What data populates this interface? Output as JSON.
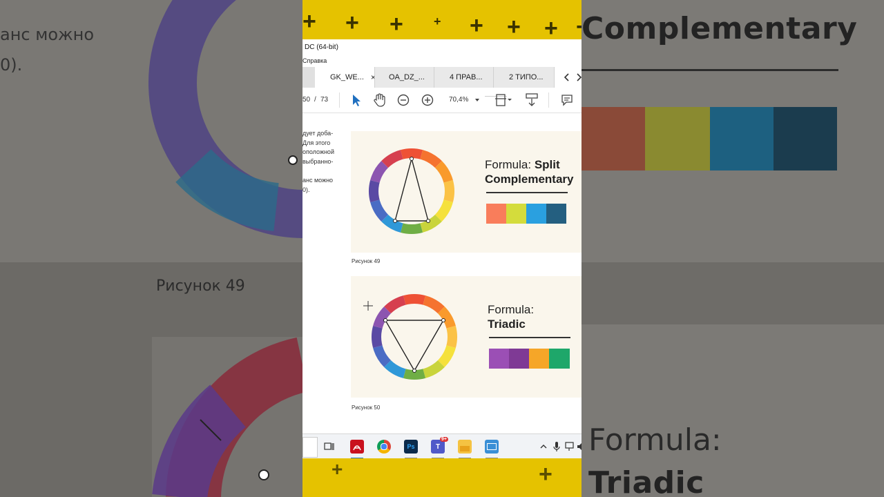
{
  "background_left": {
    "text_line1": "анс можно",
    "text_line2": "0).",
    "caption": "Рисунок 49"
  },
  "background_right": {
    "title": "Complementary",
    "formula_label": "Formula:",
    "formula_name": "Triadic",
    "swatches": [
      "#c0533a",
      "#b8b830",
      "#1d7fb0",
      "#1b4b62"
    ]
  },
  "window": {
    "title": "DC (64-bit)",
    "menu": "Справка"
  },
  "tabs": [
    {
      "label": "GK_WE...",
      "active": true,
      "close": "×"
    },
    {
      "label": "OA_DZ_...",
      "active": false
    },
    {
      "label": "4 ПРАВ...",
      "active": false
    },
    {
      "label": "2 ТИПО...",
      "active": false
    }
  ],
  "toolbar": {
    "page_current": "50",
    "page_separator": "/",
    "page_total": "73",
    "zoom": "70,4%"
  },
  "document": {
    "side_text": [
      "дует доба-",
      "Для этого",
      "оположной",
      "выбранно-",
      "анс можно",
      "0)."
    ],
    "figure1": {
      "formula_label": "Formula:",
      "formula_name_line1": "Split",
      "formula_name_line2": "Complementary",
      "swatches": [
        "#f97d5b",
        "#d4dc3c",
        "#2aa0e0",
        "#245f80"
      ],
      "caption": "Рисунок 49"
    },
    "figure2": {
      "formula_label": "Formula:",
      "formula_name": "Triadic",
      "swatches": [
        "#9b4fb5",
        "#7f3a95",
        "#f6a628",
        "#1ea76a"
      ],
      "caption": "Рисунок 50"
    }
  },
  "wheel_colors": [
    "#ee5135",
    "#f5732f",
    "#f99a2c",
    "#fbc246",
    "#f5e13c",
    "#c9d43c",
    "#6fae45",
    "#2f98d8",
    "#4a6cc4",
    "#5a4aa4",
    "#8c55b0",
    "#d6404f"
  ],
  "taskbar": {
    "icons": [
      "task-view",
      "acrobat",
      "chrome",
      "photoshop",
      "teams",
      "file-explorer",
      "remote-desktop"
    ],
    "teams_badge": "9+",
    "ps_label": "Ps"
  }
}
